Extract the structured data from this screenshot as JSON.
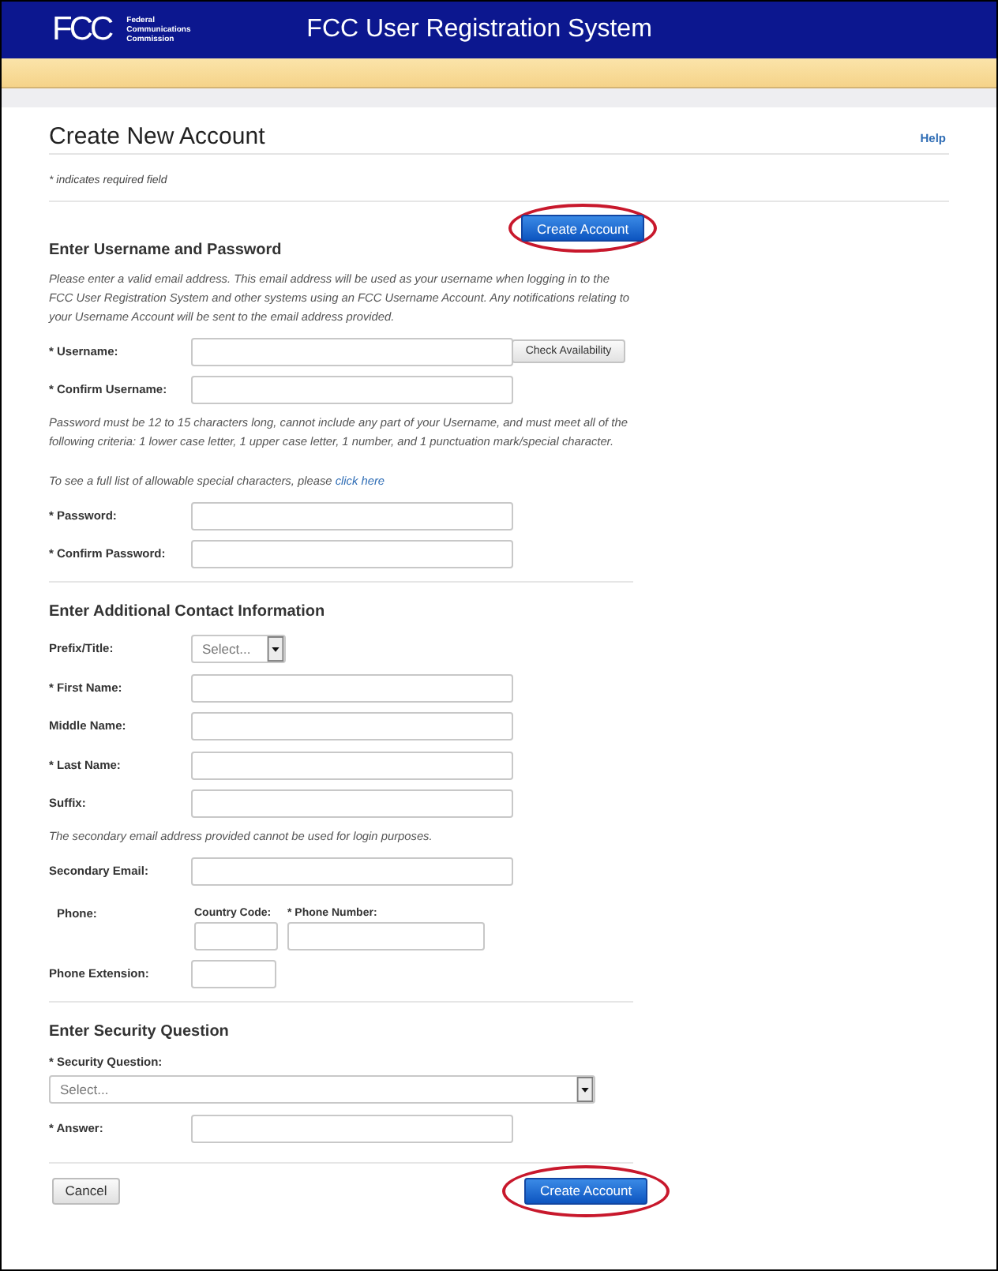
{
  "header": {
    "logo": "FCC",
    "agency": "Federal Communications Commission",
    "title": "FCC User Registration System"
  },
  "page": {
    "title": "Create New Account",
    "help": "Help",
    "required_note": "* indicates required field"
  },
  "top_actions": [
    {
      "label": "Create Account",
      "kind": "primary",
      "highlighted": true
    }
  ],
  "sections": [
    {
      "heading": "Enter Username and Password",
      "items": [
        {
          "kind": "note",
          "text": "Please enter a valid email address. This email address will be used as your username when logging in to the FCC User Registration System and other systems using an FCC Username Account. Any notifications relating to your Username Account will be sent to the email address provided."
        },
        {
          "kind": "field",
          "label": "* Username:",
          "button": "Check Availability"
        },
        {
          "kind": "field",
          "label": "* Confirm Username:"
        },
        {
          "kind": "note",
          "text": "Password must be 12 to 15 characters long, cannot include any part of your Username, and must meet all of the following criteria: 1 lower case letter, 1 upper case letter, 1 number, and 1 punctuation mark/special character."
        },
        {
          "kind": "note",
          "text": "To see a full list of allowable special characters, please ",
          "link": "click here"
        },
        {
          "kind": "field",
          "label": "* Password:"
        },
        {
          "kind": "field",
          "label": "* Confirm Password:"
        }
      ]
    },
    {
      "heading": "Enter Additional Contact Information",
      "items": [
        {
          "kind": "select",
          "label": "Prefix/Title:",
          "value": "Select..."
        },
        {
          "kind": "field",
          "label": "* First Name:"
        },
        {
          "kind": "field",
          "label": "Middle Name:"
        },
        {
          "kind": "field",
          "label": "* Last Name:"
        },
        {
          "kind": "field",
          "label": "Suffix:"
        },
        {
          "kind": "note",
          "text": "The secondary email address provided cannot be used for login purposes."
        },
        {
          "kind": "field",
          "label": "Secondary Email:"
        },
        {
          "kind": "phone",
          "label": "Phone:",
          "parts": [
            {
              "label": "Country Code:"
            },
            {
              "label": "* Phone Number:"
            }
          ]
        },
        {
          "kind": "short_field",
          "label": "Phone Extension:"
        }
      ]
    },
    {
      "heading": "Enter Security Question",
      "items": [
        {
          "kind": "stacked_select",
          "label": "* Security Question:",
          "value": "Select..."
        },
        {
          "kind": "field",
          "label": "* Answer:"
        }
      ]
    }
  ],
  "actions": [
    {
      "label": "Cancel",
      "kind": "secondary",
      "highlighted": false
    },
    {
      "label": "Create Account",
      "kind": "primary",
      "highlighted": true
    }
  ]
}
